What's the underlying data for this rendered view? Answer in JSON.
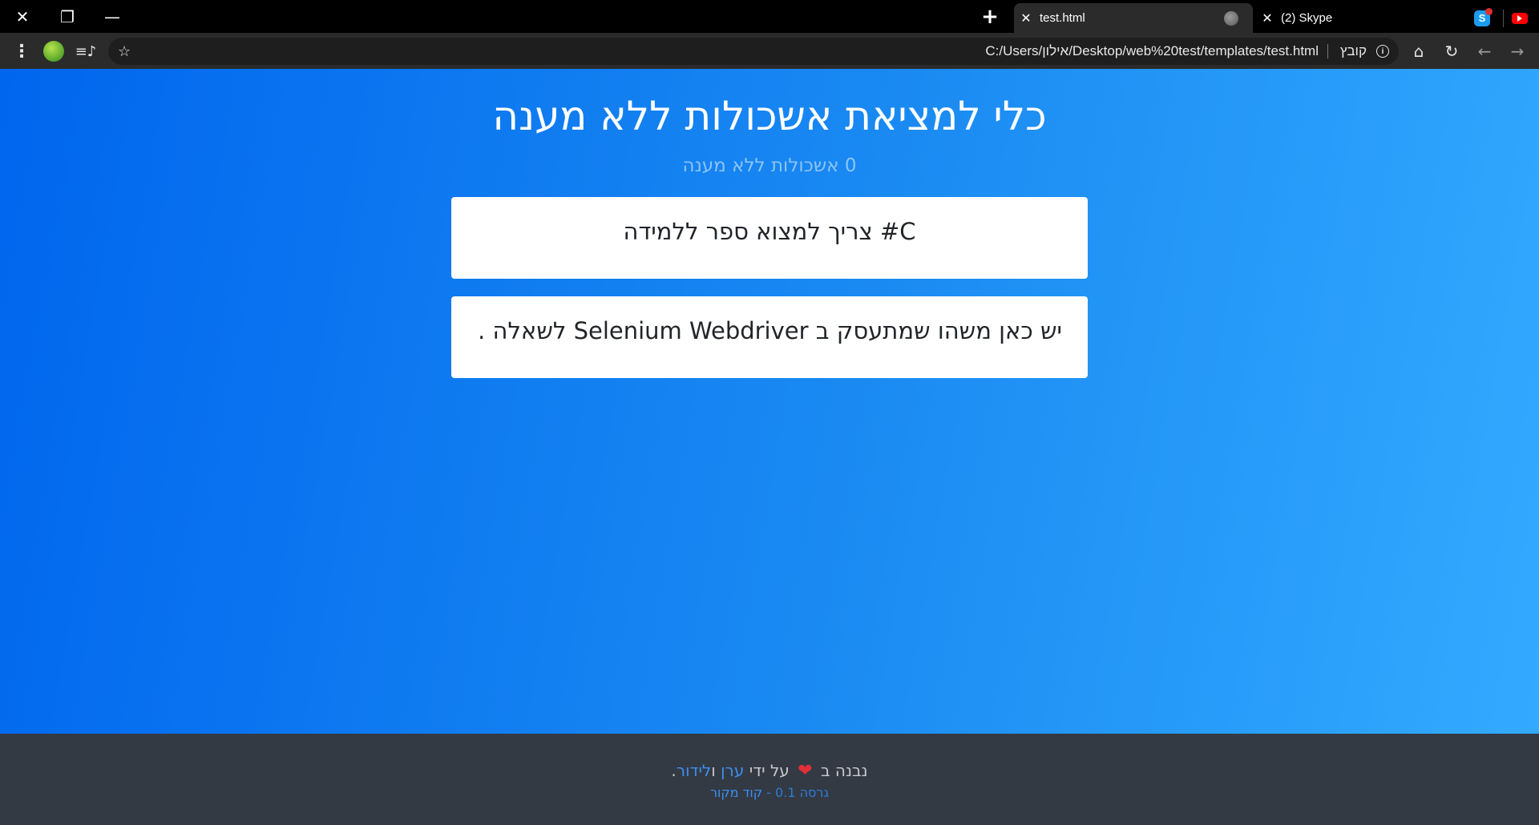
{
  "browser": {
    "tabs": [
      {
        "title": "test.html",
        "active": true,
        "icon": "globe-icon"
      },
      {
        "title": "(2) Skype",
        "active": false,
        "icon": "skype-icon"
      }
    ],
    "address_bar": {
      "scheme_label": "קובץ",
      "url": "C:/Users/אילון/Desktop/web%20test/templates/test.html"
    }
  },
  "page": {
    "title": "כלי למציאת אשכולות ללא מענה",
    "subtitle": "0 אשכולות ללא מענה",
    "threads": [
      {
        "text": "C# צריך למצוא ספר ללמידה"
      },
      {
        "text": "יש כאן משהו שמתעסק ב Selenium Webdriver לשאלה ."
      }
    ]
  },
  "footer": {
    "built_with": "נבנה ב",
    "by": "על ידי",
    "author1": "ערן",
    "and": "ו",
    "author2": "לידור",
    "period": ".",
    "version": "גרסה 0.1",
    "dash": "-",
    "source_link": "קוד מקור"
  },
  "colors": {
    "gradient_start": "#0066ee",
    "gradient_end": "#33aaff",
    "footer_bg": "#333a44",
    "link": "#3d8ef0",
    "heart": "#e0303a"
  }
}
